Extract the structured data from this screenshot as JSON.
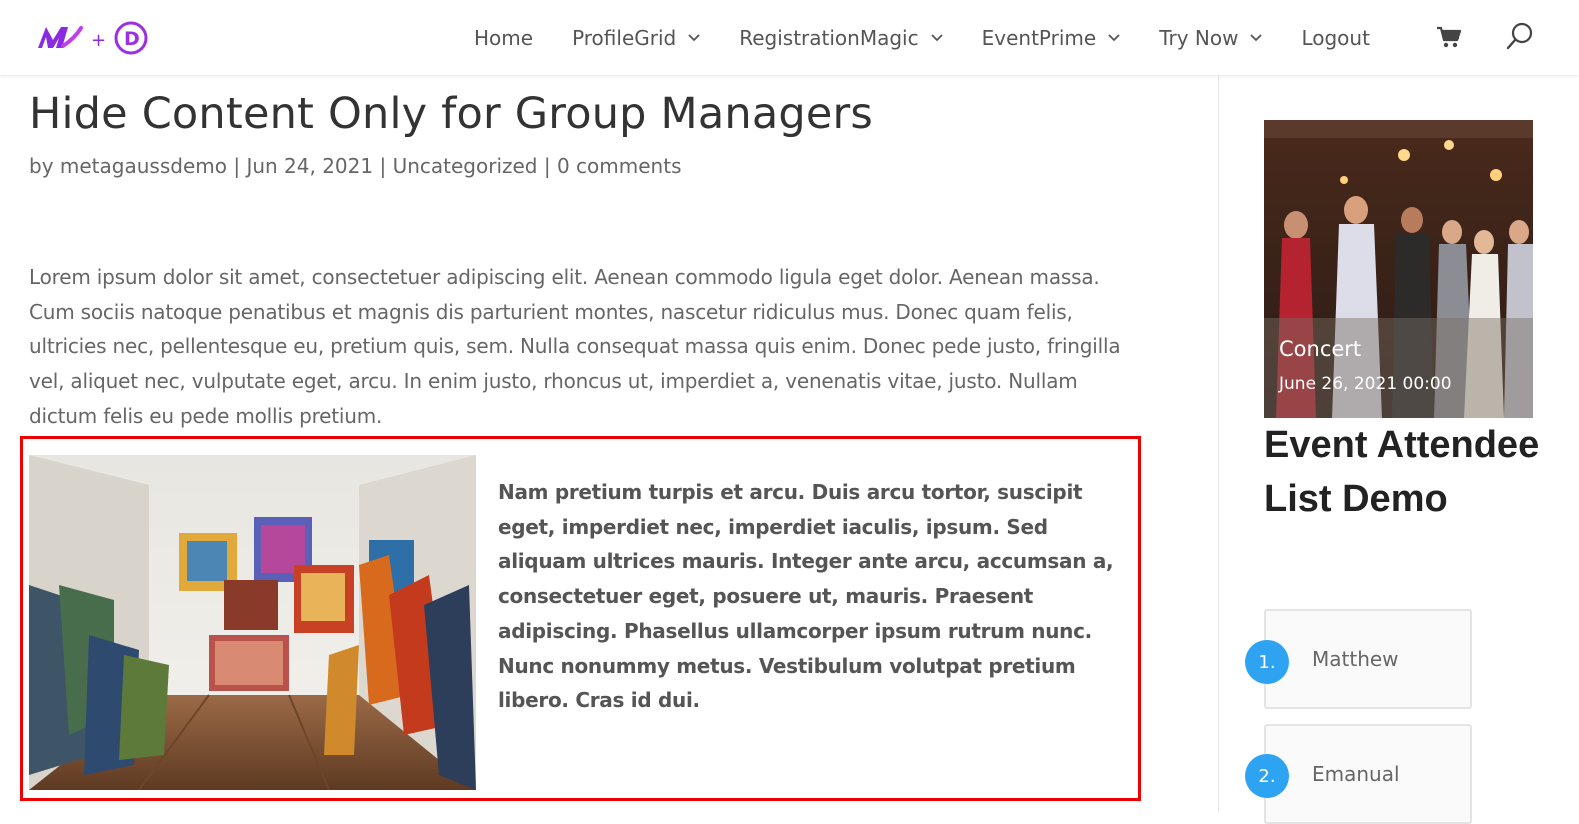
{
  "header": {
    "logo_alt": "M + D",
    "nav": [
      {
        "label": "Home",
        "dropdown": false
      },
      {
        "label": "ProfileGrid",
        "dropdown": true
      },
      {
        "label": "RegistrationMagic",
        "dropdown": true
      },
      {
        "label": "EventPrime",
        "dropdown": true
      },
      {
        "label": "Try Now",
        "dropdown": true
      },
      {
        "label": "Logout",
        "dropdown": false
      }
    ],
    "icons": {
      "cart": "cart-icon",
      "search": "search-icon"
    }
  },
  "post": {
    "title": "Hide Content Only for Group Managers",
    "meta": {
      "by": "by",
      "author": "metagaussdemo",
      "sep": "|",
      "date": "Jun 24, 2021",
      "category": "Uncategorized",
      "comments": "0 comments"
    },
    "paragraph": "Lorem ipsum dolor sit amet, consectetuer adipiscing elit. Aenean commodo ligula eget dolor. Aenean massa. Cum sociis natoque penatibus et magnis dis parturient montes, nascetur ridiculus mus. Donec quam felis, ultricies nec, pellentesque eu, pretium quis, sem. Nulla consequat massa quis enim. Donec pede justo, fringilla vel, aliquet nec, vulputate eget, arcu. In enim justo, rhoncus ut, imperdiet a, venenatis vitae, justo. Nullam dictum felis eu pede mollis pretium.",
    "highlight_text": "Nam pretium turpis et arcu. Duis arcu tortor, suscipit eget, imperdiet nec, imperdiet iaculis, ipsum. Sed aliquam ultrices mauris. Integer ante arcu, accumsan a, consectetuer eget, posuere ut, mauris. Praesent adipiscing. Phasellus ullamcorper ipsum rutrum nunc. Nunc nonummy metus. Vestibulum volutpat pretium libero. Cras id dui."
  },
  "sidebar": {
    "event": {
      "name": "Concert",
      "date": "June 26, 2021 00:00"
    },
    "widget_title": "Event Attendee List Demo",
    "attendees": [
      {
        "num": "1.",
        "name": "Matthew"
      },
      {
        "num": "2.",
        "name": "Emanual"
      }
    ]
  },
  "colors": {
    "accent": "#2ea3f2",
    "highlight_border": "#ee0000",
    "logo_purple": "#8a2be2"
  }
}
